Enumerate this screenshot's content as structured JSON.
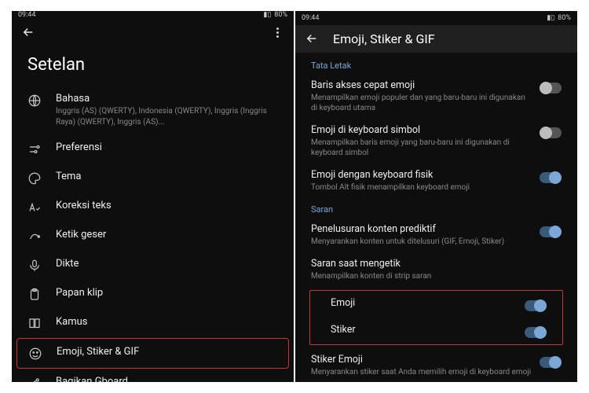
{
  "status": {
    "time": "09:44",
    "battery": "80%"
  },
  "left": {
    "page_title": "Setelan",
    "items": [
      {
        "name": "bahasa",
        "title": "Bahasa",
        "sub": "Inggris (AS) (QWERTY), Indonesia (QWERTY), Inggris (Inggris Raya) (QWERTY), Inggris (AS)..."
      },
      {
        "name": "preferensi",
        "title": "Preferensi"
      },
      {
        "name": "tema",
        "title": "Tema"
      },
      {
        "name": "koreksi-teks",
        "title": "Koreksi teks"
      },
      {
        "name": "ketik-geser",
        "title": "Ketik geser"
      },
      {
        "name": "dikte",
        "title": "Dikte"
      },
      {
        "name": "papan-klip",
        "title": "Papan klip"
      },
      {
        "name": "kamus",
        "title": "Kamus"
      },
      {
        "name": "emoji-stiker-gif",
        "title": "Emoji, Stiker & GIF",
        "highlight": true
      },
      {
        "name": "bagikan-gboard",
        "title": "Bagikan Gboard"
      }
    ]
  },
  "right": {
    "header_title": "Emoji, Stiker & GIF",
    "section_layout": "Tata Letak",
    "section_suggestions": "Saran",
    "settings_layout": [
      {
        "name": "baris-akses-cepat",
        "title": "Baris akses cepat emoji",
        "desc": "Menampilkan emoji populer dan yang baru-baru ini digunakan di keyboard utama",
        "on": false
      },
      {
        "name": "emoji-keyboard-simbol",
        "title": "Emoji di keyboard simbol",
        "desc": "Menampilkan baris emoji yang baru-baru ini digunakan di keyboard simbol",
        "on": false
      },
      {
        "name": "emoji-keyboard-fisik",
        "title": "Emoji dengan keyboard fisik",
        "desc": "Tombol Alt fisik menampilkan keyboard emoji",
        "on": true
      }
    ],
    "settings_sugg": [
      {
        "name": "penelusuran-prediktif",
        "title": "Penelusuran konten prediktif",
        "desc": "Menyarankan konten untuk ditelusuri (GIF, Emoji, Stiker)",
        "on": true
      }
    ],
    "typing_header": {
      "title": "Saran saat mengetik",
      "desc": "Menampilkan konten di strip saran"
    },
    "typing_items": [
      {
        "name": "saran-emoji",
        "title": "Emoji",
        "on": true
      },
      {
        "name": "saran-stiker",
        "title": "Stiker",
        "on": true
      }
    ],
    "sticker_emoji": {
      "title": "Stiker Emoji",
      "desc": "Menyarankan stiker saat Anda memilih emoji di keyboard emoji",
      "on": true
    }
  }
}
